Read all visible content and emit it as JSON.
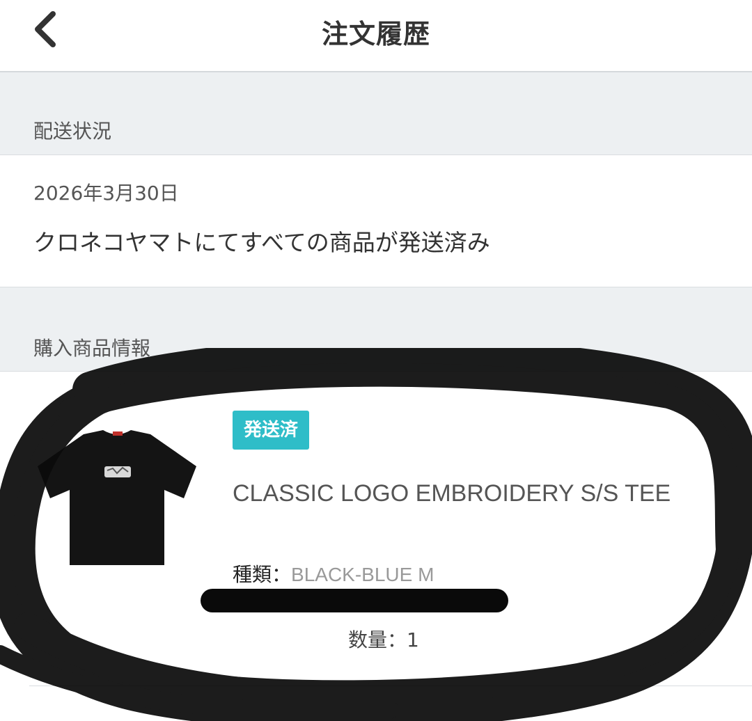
{
  "header": {
    "title": "注文履歴",
    "back_icon": "chevron-left-icon"
  },
  "shipping": {
    "section_label": "配送状況",
    "date": "2026年3月30日",
    "status": "クロネコヤマトにてすべての商品が発送済み"
  },
  "purchase": {
    "section_label": "購入商品情報",
    "item": {
      "badge": "発送済",
      "name": "CLASSIC LOGO EMBROIDERY S/S TEE",
      "variant_label": "種類：",
      "variant_value": "BLACK-BLUE M",
      "quantity_text": "数量：1",
      "image_icon": "black-tshirt-image"
    }
  },
  "colors": {
    "badge": "#2ebdc8",
    "section_bg": "#edf0f2",
    "text": "#333333"
  }
}
